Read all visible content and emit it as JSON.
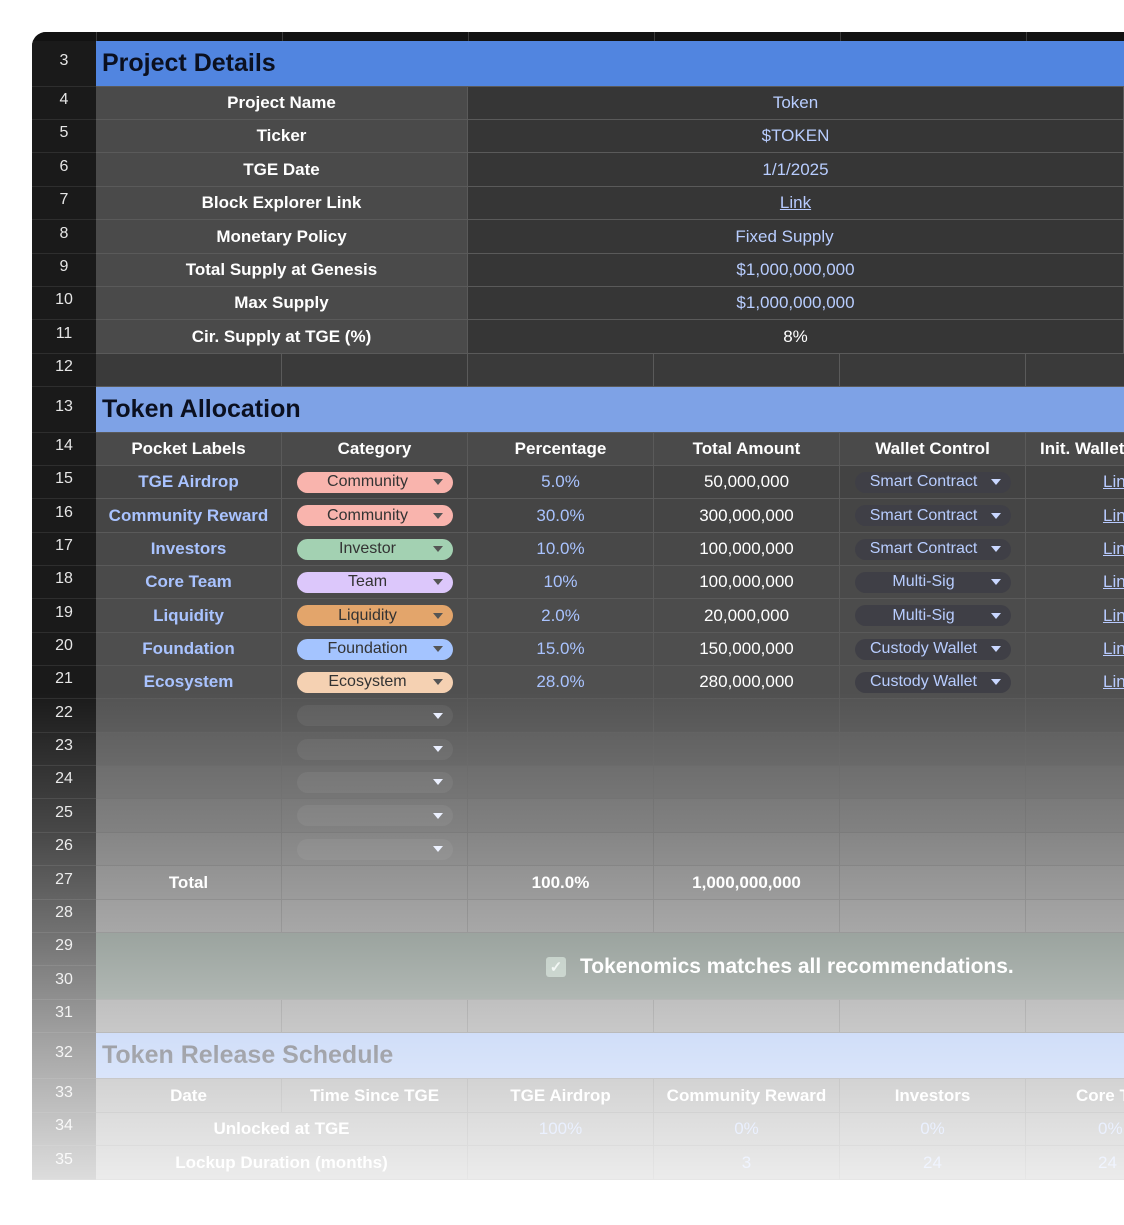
{
  "row_numbers": [
    "3",
    "4",
    "5",
    "6",
    "7",
    "8",
    "9",
    "10",
    "11",
    "12",
    "13",
    "14",
    "15",
    "16",
    "17",
    "18",
    "19",
    "20",
    "21",
    "22",
    "23",
    "24",
    "25",
    "26",
    "27",
    "28",
    "29",
    "30",
    "31",
    "32",
    "33",
    "34",
    "35"
  ],
  "project_details": {
    "title": "Project Details",
    "rows": [
      {
        "label": "Project Name",
        "value": "Token"
      },
      {
        "label": "Ticker",
        "value": "$TOKEN"
      },
      {
        "label": "TGE Date",
        "value": "1/1/2025"
      },
      {
        "label": "Block Explorer Link",
        "value": "Link"
      },
      {
        "label": "Monetary Policy",
        "value": "Fixed Supply"
      },
      {
        "label": "Total Supply at Genesis",
        "value": "$1,000,000,000"
      },
      {
        "label": "Max Supply",
        "value": "$1,000,000,000"
      },
      {
        "label": "Cir. Supply at TGE (%)",
        "value": "8%"
      }
    ]
  },
  "token_allocation": {
    "title": "Token Allocation",
    "headers": [
      "Pocket Labels",
      "Category",
      "Percentage",
      "Total Amount",
      "Wallet Control",
      "Init. Wallet"
    ],
    "rows": [
      {
        "label": "TGE Airdrop",
        "category": "Community",
        "percentage": "5.0%",
        "amount": "50,000,000",
        "wallet": "Smart Contract",
        "link": "Link"
      },
      {
        "label": "Community Reward",
        "category": "Community",
        "percentage": "30.0%",
        "amount": "300,000,000",
        "wallet": "Smart Contract",
        "link": "Link"
      },
      {
        "label": "Investors",
        "category": "Investor",
        "percentage": "10.0%",
        "amount": "100,000,000",
        "wallet": "Smart Contract",
        "link": "Link"
      },
      {
        "label": "Core Team",
        "category": "Team",
        "percentage": "10%",
        "amount": "100,000,000",
        "wallet": "Multi-Sig",
        "link": "Link"
      },
      {
        "label": "Liquidity",
        "category": "Liquidity",
        "percentage": "2.0%",
        "amount": "20,000,000",
        "wallet": "Multi-Sig",
        "link": "Link"
      },
      {
        "label": "Foundation",
        "category": "Foundation",
        "percentage": "15.0%",
        "amount": "150,000,000",
        "wallet": "Custody Wallet",
        "link": "Link"
      },
      {
        "label": "Ecosystem",
        "category": "Ecosystem",
        "percentage": "28.0%",
        "amount": "280,000,000",
        "wallet": "Custody Wallet",
        "link": "Link"
      }
    ],
    "total": {
      "label": "Total",
      "percentage": "100.0%",
      "amount": "1,000,000,000"
    }
  },
  "category_colors": {
    "Community": "#f9b4ad",
    "Investor": "#a3d1b2",
    "Team": "#dcc7fb",
    "Liquidity": "#e3a56b",
    "Foundation": "#a4c4ff",
    "Ecosystem": "#f5d1b2"
  },
  "status_message": "Tokenomics matches all recommendations.",
  "release_schedule": {
    "title": "Token Release Schedule",
    "headers": [
      "Date",
      "Time Since TGE",
      "TGE Airdrop",
      "Community Reward",
      "Investors",
      "Core Team"
    ],
    "unlocked_label": "Unlocked at TGE",
    "unlocked_values": [
      "100%",
      "0%",
      "0%",
      "0%"
    ],
    "lockup_label": "Lockup Duration (months)",
    "lockup_values": [
      "",
      "3",
      "24",
      "24"
    ]
  },
  "colors": {
    "project_header": "#5185e0",
    "allocation_header": "#7ea2e6",
    "schedule_header": "#8fb0f0",
    "ok_banner": "#5d6b63"
  }
}
